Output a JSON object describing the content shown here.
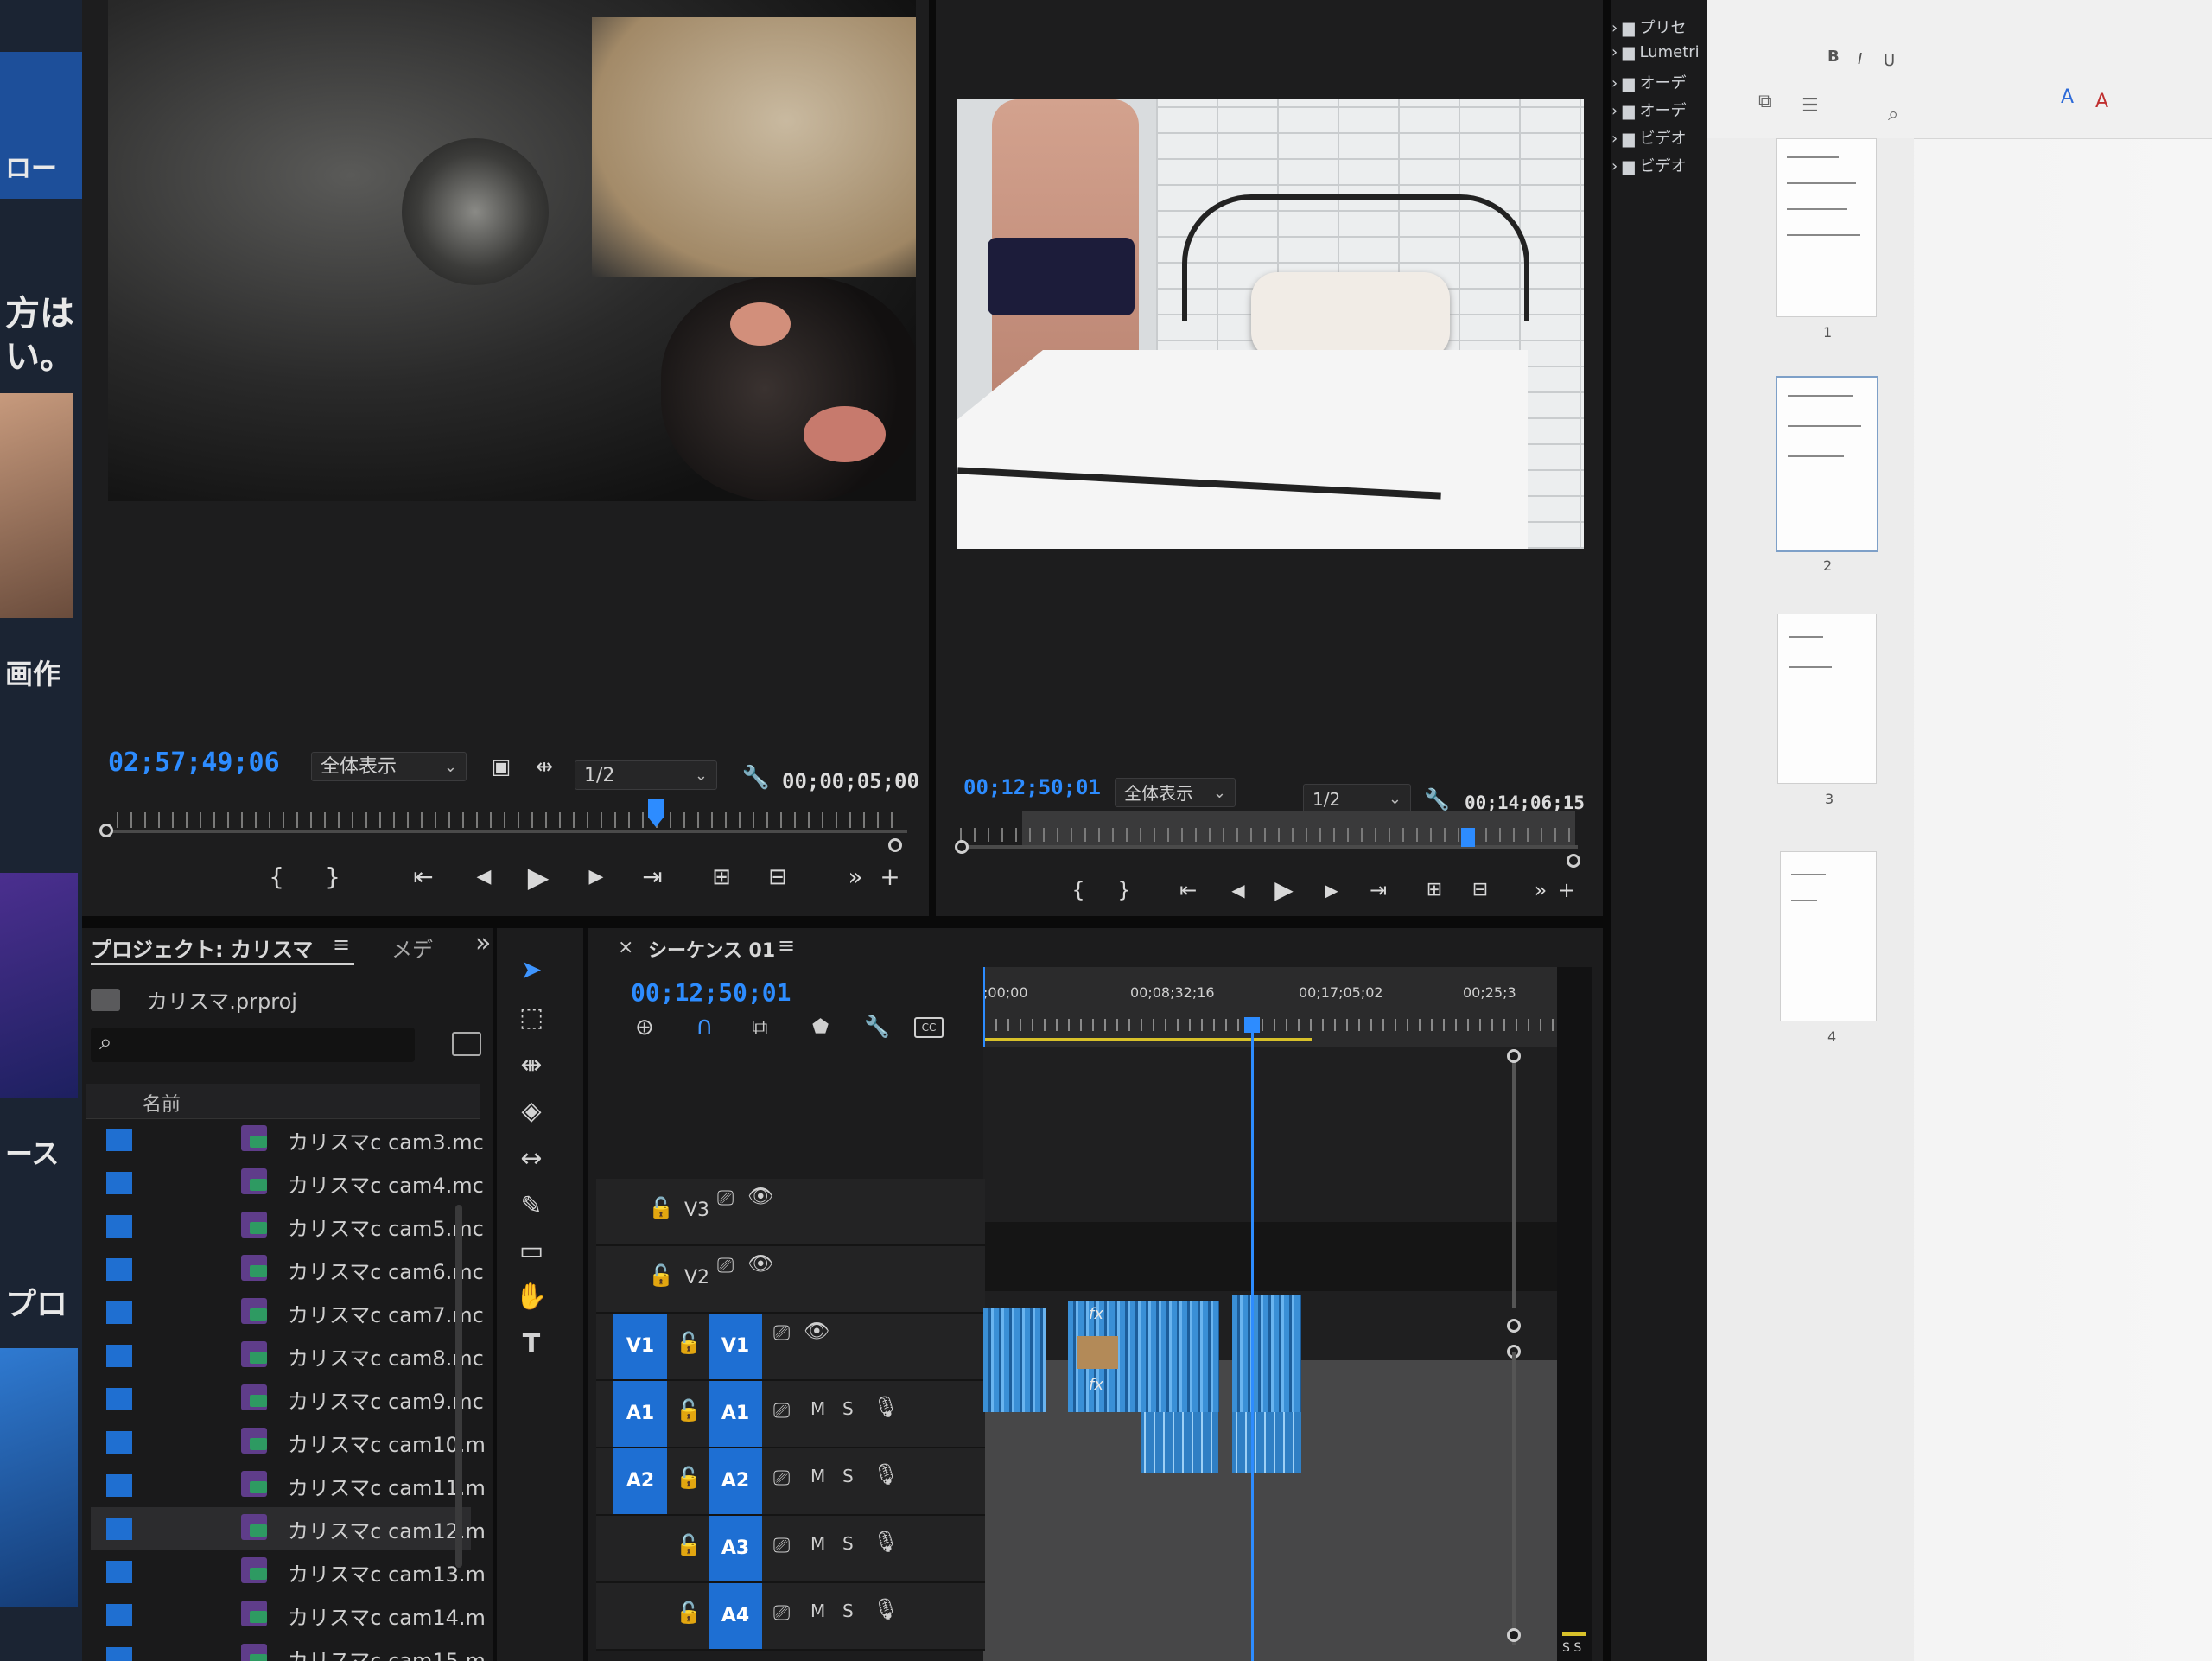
{
  "left_strip": {
    "texts": [
      "画作",
      "方は",
      "い。",
      "ース",
      "プロ",
      "ロー"
    ]
  },
  "source_monitor": {
    "timecode": "02;57;49;06",
    "zoom_select": "全体表示",
    "resolution_select": "1/2",
    "duration": "00;00;05;00"
  },
  "program_monitor": {
    "timecode": "00;12;50;01",
    "zoom_select": "全体表示",
    "resolution_select": "1/2",
    "duration": "00;14;06;15"
  },
  "transport": {
    "mark_in": "{",
    "mark_out": "}",
    "go_in": "⇤",
    "step_back": "◀",
    "play": "▶",
    "step_fwd": "▶",
    "go_out": "⇥",
    "more": "»",
    "add": "+"
  },
  "project_panel": {
    "tab_label": "プロジェクト: カリスマ",
    "tab_menu": "≡",
    "tab2_label": "メデ",
    "overflow": "»",
    "project_file": "カリスマ.prproj",
    "column_header": "名前",
    "items": [
      "カリスマc cam3.mc",
      "カリスマc cam4.mc",
      "カリスマc cam5.mc",
      "カリスマc cam6.mc",
      "カリスマc cam7.mc",
      "カリスマc cam8.mc",
      "カリスマc cam9.mc",
      "カリスマc cam10.m",
      "カリスマc cam11.m",
      "カリスマc cam12.m",
      "カリスマc cam13.m",
      "カリスマc cam14.m",
      "カリスマc cam15.m"
    ]
  },
  "timeline": {
    "tab_close": "×",
    "tab_label": "シーケンス 01",
    "tab_menu": "≡",
    "timecode": "00;12;50;01",
    "ruler_labels": [
      ";00;00",
      "00;08;32;16",
      "00;17;05;02",
      "00;25;3"
    ],
    "tracks": [
      {
        "target": "",
        "lock": "🔓",
        "name": "V3",
        "icons": [
          "⎚",
          "👁"
        ]
      },
      {
        "target": "",
        "lock": "🔓",
        "name": "V2",
        "icons": [
          "⎚",
          "👁"
        ]
      },
      {
        "target": "V1",
        "lock": "🔓",
        "name": "V1",
        "icons": [
          "⎚",
          "👁"
        ]
      },
      {
        "target": "A1",
        "lock": "🔓",
        "name": "A1",
        "icons": [
          "⎚",
          "M",
          "S",
          "🎙"
        ]
      },
      {
        "target": "A2",
        "lock": "🔓",
        "name": "A2",
        "icons": [
          "⎚",
          "M",
          "S",
          "🎙"
        ]
      },
      {
        "target": "",
        "lock": "🔓",
        "name": "A3",
        "icons": [
          "⎚",
          "M",
          "S",
          "🎙"
        ]
      },
      {
        "target": "",
        "lock": "🔓",
        "name": "A4",
        "icons": [
          "⎚",
          "M",
          "S",
          "🎙"
        ]
      }
    ],
    "fx_label": "fx",
    "meter_label": "S S"
  },
  "effects_tree": {
    "items": [
      "プリセ",
      "Lumetri",
      "オーデ",
      "オーデ",
      "ビデオ",
      "ビデオ"
    ]
  },
  "word_doc": {
    "page_numbers": [
      "1",
      "2",
      "3",
      "4"
    ]
  },
  "colors": {
    "accent_blue": "#2d8cff",
    "track_target": "#1e6fd3",
    "panel_bg": "#1d1d1e",
    "doc_bg": "#f1f1f1"
  }
}
